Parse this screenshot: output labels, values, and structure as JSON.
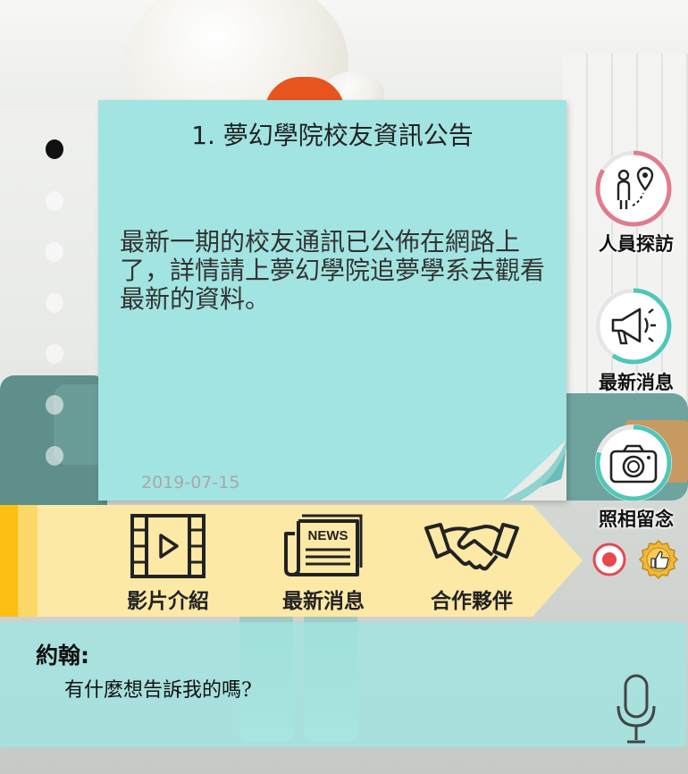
{
  "notice": {
    "title": "1. 夢幻學院校友資訊公告",
    "body": "最新一期的校友通訊已公佈在網路上了，詳情請上夢幻學院追夢學系去觀看最新的資料。",
    "date": "2019-07-15"
  },
  "pager": {
    "total": 7,
    "active_index": 0
  },
  "side_buttons": [
    {
      "icon": "visit-person-icon",
      "label": "人員探訪",
      "ring_color": "#e07c8e"
    },
    {
      "icon": "megaphone-icon",
      "label": "最新消息",
      "ring_color": "#4fc7b9"
    },
    {
      "icon": "camera-icon",
      "label": "照相留念",
      "ring_color": "#4fc7b9"
    }
  ],
  "banner": {
    "items": [
      {
        "icon": "video-icon",
        "label": "影片介紹"
      },
      {
        "icon": "news-icon",
        "label": "最新消息"
      },
      {
        "icon": "handshake-icon",
        "label": "合作夥伴"
      }
    ],
    "colors": {
      "background": "#fde9a6",
      "accent_dark": "#fcbf12",
      "accent_light": "#fcd868"
    }
  },
  "quick_buttons": [
    {
      "icon": "record-icon",
      "color": "#e8474f"
    },
    {
      "icon": "thumbs-up-icon",
      "color": "#f2b83a"
    }
  ],
  "dialog": {
    "speaker": "約翰:",
    "message": "有什麼想告訴我的嗎?",
    "mic_icon": "microphone-icon"
  }
}
